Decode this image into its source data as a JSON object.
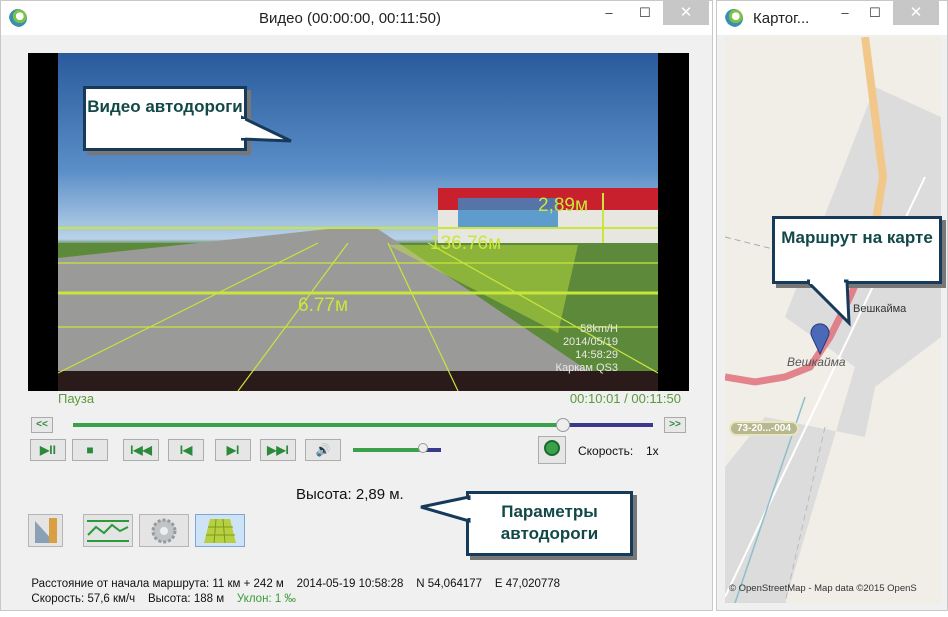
{
  "video_window": {
    "title": "Видео (00:00:00, 00:11:50)",
    "overlay": {
      "height_label": "2,89м",
      "distance_label": "136.76м",
      "near_label": "6.77м"
    },
    "osd": {
      "speed": "58km/H",
      "date": "2014/05/19",
      "time": "14:58:29",
      "camera": "Каркам QS3"
    },
    "status": "Пауза",
    "time_position": "00:10:01 / 00:11:50",
    "seek_progress": 0.845,
    "volume_level": 0.8,
    "buttons": {
      "rewind": "<<",
      "forward": ">>",
      "play_pause": "▶II",
      "stop": "■",
      "first": "I◀◀",
      "prev": "I◀",
      "next": "▶I",
      "last": "▶▶I",
      "volume": "🔊"
    },
    "speed_label": "Скорость:",
    "speed_value": "1x",
    "height_readout": "Высота: 2,89 м.",
    "info_line1": {
      "distance": "Расстояние от начала маршрута: 11 км + 242 м",
      "datetime": "2014-05-19 10:58:28",
      "lat": "N 54,064177",
      "lon": "E 47,020778"
    },
    "info_line2": {
      "speed": "Скорость: 57,6 км/ч",
      "altitude": "Высота: 188 м",
      "slope": "Уклон: 1 ‰"
    },
    "callout_video": "Видео автодороги",
    "callout_params": "Параметры автодороги"
  },
  "map_window": {
    "title": "Картог...",
    "place_label_1": "Вешкайма",
    "place_label_2": "Вешкайма",
    "road_ref": "73-20...-004",
    "attribution": "© OpenStreetMap - Map data ©2015 OpenS",
    "callout": "Маршрут на карте"
  },
  "window_controls": {
    "minimize": "–",
    "maximize": "☐",
    "close": "✕"
  },
  "colors": {
    "accent_green": "#3aa04a",
    "track_blue": "#3a3a8c",
    "route": "#e0707a",
    "callout_border": "#163a5a"
  }
}
